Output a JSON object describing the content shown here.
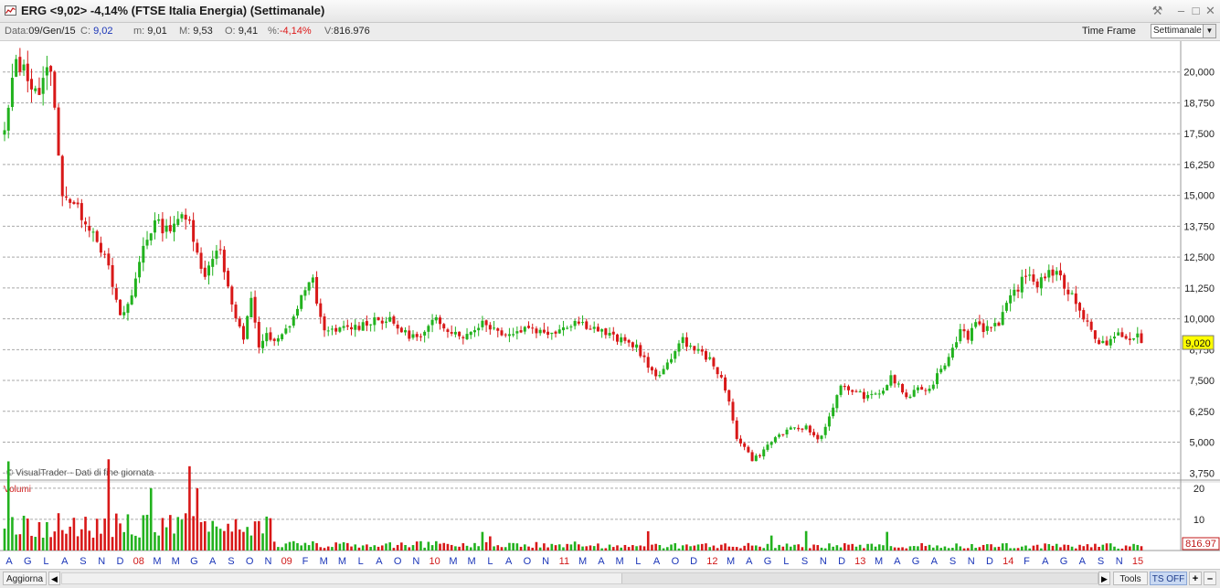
{
  "window": {
    "title": "ERG <9,02> -4,14%  (FTSE Italia Energia)  (Settimanale)",
    "buttons": {
      "tools": "⚒",
      "minimize": "–",
      "maximize": "□",
      "close": "✕"
    }
  },
  "info": {
    "date_label": "Data:",
    "date_value": "09/Gen/15",
    "close_label": "C:",
    "close_value": "9,02",
    "min_label": "m:",
    "min_value": "9,01",
    "max_label": "M:",
    "max_value": "9,53",
    "open_label": "O:",
    "open_value": "9,41",
    "pct_label": "%:",
    "pct_value": "-4,14%",
    "vol_label": "V:",
    "vol_value": "816.976",
    "timeframe_label": "Time Frame",
    "timeframe_value": "Settimanale"
  },
  "colors": {
    "up": "#22b21e",
    "down": "#d81818",
    "grid": "#a9a9a9",
    "month_blue": "#1a35b8",
    "year_red": "#d01818",
    "price_tag": "#ffff00"
  },
  "bottom": {
    "refresh": "Aggiorna",
    "tools": "Tools",
    "ts": "TS OFF",
    "plus": "+",
    "minus": "–"
  },
  "chart_data": {
    "type": "candlestick",
    "title": "ERG <9,02> -4,14%  (FTSE Italia Energia)  (Settimanale)",
    "watermark": "© VisualTrader - Dati di fine giornata",
    "price_axis": {
      "ticks": [
        "3,750",
        "5,000",
        "6,250",
        "7,500",
        "8,750",
        "10,000",
        "11,250",
        "12,500",
        "13,750",
        "15,000",
        "16,250",
        "17,500",
        "18,750",
        "20,000"
      ],
      "tick_values": [
        3.75,
        5.0,
        6.25,
        7.5,
        8.75,
        10.0,
        11.25,
        12.5,
        13.75,
        15.0,
        16.25,
        17.5,
        18.75,
        20.0
      ],
      "range": [
        3.5,
        21.25
      ]
    },
    "last_price_tag": "9,020",
    "volume_panel": {
      "label": "Volumi",
      "ticks": [
        "20",
        "10"
      ],
      "tick_values": [
        20,
        10
      ],
      "last_volume_tag": "816.97"
    },
    "x_labels": [
      "A",
      "G",
      "L",
      "A",
      "S",
      "N",
      "D",
      "08",
      "M",
      "M",
      "G",
      "A",
      "S",
      "O",
      "N",
      "09",
      "F",
      "M",
      "M",
      "L",
      "A",
      "O",
      "N",
      "10",
      "M",
      "M",
      "L",
      "A",
      "O",
      "N",
      "11",
      "M",
      "A",
      "M",
      "L",
      "A",
      "O",
      "D",
      "12",
      "M",
      "A",
      "G",
      "L",
      "S",
      "N",
      "D",
      "13",
      "M",
      "A",
      "G",
      "A",
      "S",
      "N",
      "D",
      "14",
      "F",
      "A",
      "G",
      "A",
      "S",
      "N",
      "15"
    ],
    "year_labels": [
      "08",
      "09",
      "10",
      "11",
      "12",
      "13",
      "14",
      "15"
    ],
    "price_path": [
      [
        0,
        17.5
      ],
      [
        3,
        20.5
      ],
      [
        6,
        19.8
      ],
      [
        9,
        19.2
      ],
      [
        12,
        20.3
      ],
      [
        14,
        16.5
      ],
      [
        15,
        15.2
      ],
      [
        18,
        14.6
      ],
      [
        21,
        14.0
      ],
      [
        24,
        13.3
      ],
      [
        27,
        12.0
      ],
      [
        30,
        10.0
      ],
      [
        33,
        10.9
      ],
      [
        36,
        13.0
      ],
      [
        39,
        13.9
      ],
      [
        42,
        13.6
      ],
      [
        45,
        14.1
      ],
      [
        48,
        13.9
      ],
      [
        50,
        12.8
      ],
      [
        52,
        11.6
      ],
      [
        54,
        12.6
      ],
      [
        56,
        12.9
      ],
      [
        58,
        11.2
      ],
      [
        60,
        10.0
      ],
      [
        62,
        9.1
      ],
      [
        64,
        10.9
      ],
      [
        66,
        8.9
      ],
      [
        68,
        9.3
      ],
      [
        70,
        9.0
      ],
      [
        72,
        9.3
      ],
      [
        74,
        9.8
      ],
      [
        76,
        10.4
      ],
      [
        78,
        11.3
      ],
      [
        80,
        11.5
      ],
      [
        82,
        10.0
      ],
      [
        84,
        9.4
      ],
      [
        88,
        9.6
      ],
      [
        92,
        9.7
      ],
      [
        96,
        10.0
      ],
      [
        100,
        9.9
      ],
      [
        104,
        9.4
      ],
      [
        108,
        9.2
      ],
      [
        112,
        10.0
      ],
      [
        116,
        9.5
      ],
      [
        120,
        9.3
      ],
      [
        124,
        9.9
      ],
      [
        128,
        9.5
      ],
      [
        132,
        9.4
      ],
      [
        136,
        9.7
      ],
      [
        140,
        9.4
      ],
      [
        144,
        9.6
      ],
      [
        148,
        9.9
      ],
      [
        152,
        9.7
      ],
      [
        156,
        9.4
      ],
      [
        160,
        9.1
      ],
      [
        164,
        8.9
      ],
      [
        168,
        7.8
      ],
      [
        170,
        7.6
      ],
      [
        172,
        8.3
      ],
      [
        176,
        9.1
      ],
      [
        180,
        8.7
      ],
      [
        184,
        8.2
      ],
      [
        186,
        7.5
      ],
      [
        188,
        6.6
      ],
      [
        190,
        5.2
      ],
      [
        192,
        4.8
      ],
      [
        194,
        4.3
      ],
      [
        196,
        4.5
      ],
      [
        200,
        5.2
      ],
      [
        204,
        5.5
      ],
      [
        208,
        5.6
      ],
      [
        211,
        5.1
      ],
      [
        213,
        5.6
      ],
      [
        215,
        6.5
      ],
      [
        217,
        7.2
      ],
      [
        220,
        7.1
      ],
      [
        224,
        6.8
      ],
      [
        228,
        7.1
      ],
      [
        230,
        7.6
      ],
      [
        232,
        7.3
      ],
      [
        234,
        6.8
      ],
      [
        236,
        7.0
      ],
      [
        238,
        7.2
      ],
      [
        240,
        7.1
      ],
      [
        242,
        7.8
      ],
      [
        244,
        8.2
      ],
      [
        246,
        8.9
      ],
      [
        248,
        9.5
      ],
      [
        250,
        9.3
      ],
      [
        252,
        9.9
      ],
      [
        254,
        9.6
      ],
      [
        256,
        9.8
      ],
      [
        258,
        9.7
      ],
      [
        260,
        10.5
      ],
      [
        262,
        11.1
      ],
      [
        264,
        11.5
      ],
      [
        266,
        11.8
      ],
      [
        268,
        11.4
      ],
      [
        270,
        11.8
      ],
      [
        272,
        11.9
      ],
      [
        274,
        11.6
      ],
      [
        276,
        11.1
      ],
      [
        278,
        10.7
      ],
      [
        280,
        10.1
      ],
      [
        282,
        9.5
      ],
      [
        284,
        9.1
      ],
      [
        286,
        9.0
      ],
      [
        288,
        9.2
      ],
      [
        290,
        9.4
      ],
      [
        292,
        9.1
      ],
      [
        294,
        9.3
      ],
      [
        295,
        9.02
      ]
    ]
  }
}
